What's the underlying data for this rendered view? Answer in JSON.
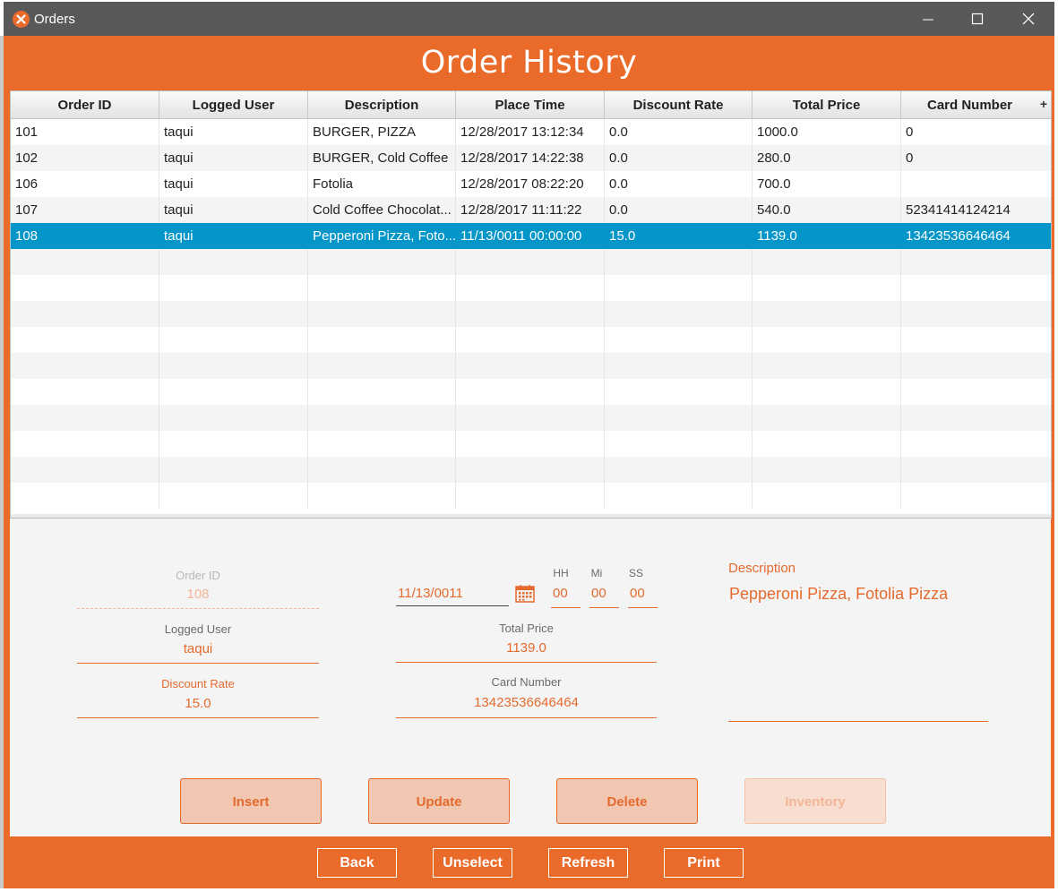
{
  "window": {
    "title": "Orders",
    "icon": "app-logo-icon",
    "controls": [
      "minimize-icon",
      "maximize-icon",
      "close-icon"
    ],
    "accent_color": "#ea6a2a",
    "titlebar_color": "#595959"
  },
  "page_title": "Order History",
  "table": {
    "columns": [
      "Order ID",
      "Logged User",
      "Description",
      "Place Time",
      "Discount Rate",
      "Total Price",
      "Card Number"
    ],
    "menu_button": "+",
    "rows": [
      [
        "101",
        "taqui",
        "BURGER, PIZZA",
        "12/28/2017 13:12:34",
        "0.0",
        "1000.0",
        "0"
      ],
      [
        "102",
        "taqui",
        "BURGER, Cold Coffee",
        "12/28/2017 14:22:38",
        "0.0",
        "280.0",
        "0"
      ],
      [
        "106",
        "taqui",
        "Fotolia",
        "12/28/2017 08:22:20",
        "0.0",
        "700.0",
        ""
      ],
      [
        "107",
        "taqui",
        "Cold Coffee Chocolat...",
        "12/28/2017 11:11:22",
        "0.0",
        "540.0",
        "52341414124214"
      ],
      [
        "108",
        "taqui",
        "Pepperoni Pizza, Foto...",
        "11/13/0011 00:00:00",
        "15.0",
        "1139.0",
        "13423536646464"
      ]
    ],
    "selected_row": 4,
    "selected_color": "#0495c9"
  },
  "form": {
    "order_id_label": "Order ID",
    "order_id": "108",
    "logged_user_label": "Logged User",
    "logged_user": "taqui",
    "discount_rate_label": "Discount Rate",
    "discount_rate": "15.0",
    "date": "11/13/0011",
    "hh_label": "HH",
    "hh": "00",
    "mi_label": "Mi",
    "mi": "00",
    "ss_label": "SS",
    "ss": "00",
    "total_price_label": "Total Price",
    "total_price": "1139.0",
    "card_number_label": "Card Number",
    "card_number": "13423536646464",
    "description_label": "Description",
    "description": "Pepperoni Pizza, Fotolia Pizza"
  },
  "actions": {
    "insert": "Insert",
    "update": "Update",
    "delete": "Delete",
    "inventory": "Inventory"
  },
  "bottom": {
    "back": "Back",
    "unselect": "Unselect",
    "refresh": "Refresh",
    "print": "Print"
  }
}
